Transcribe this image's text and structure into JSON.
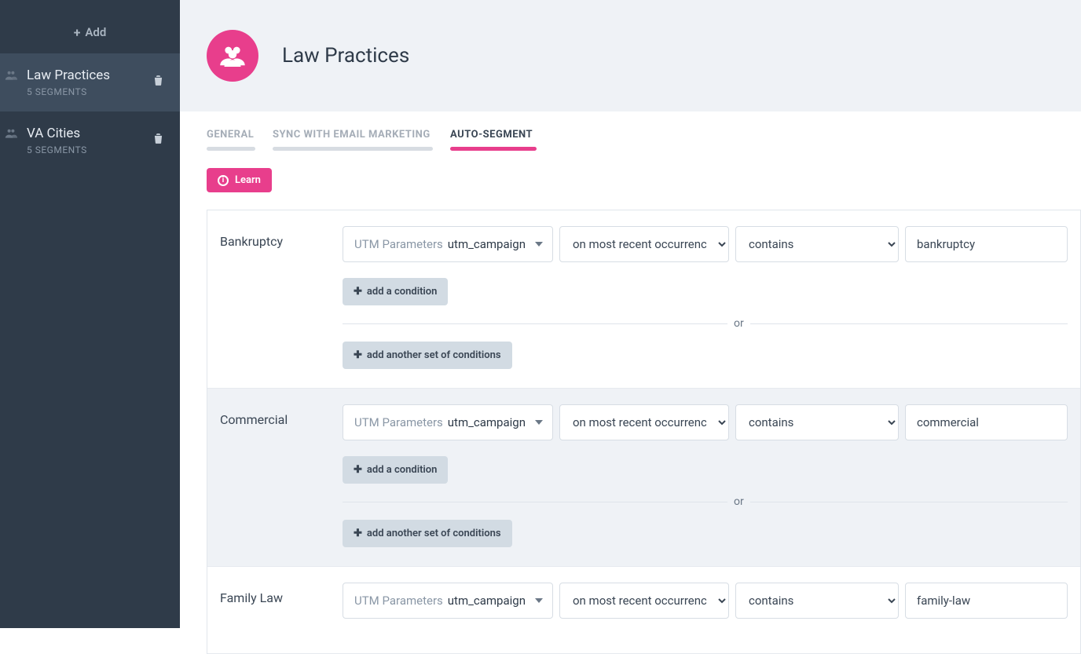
{
  "sidebar": {
    "add_label": "Add",
    "items": [
      {
        "title": "Law Practices",
        "sub": "5 SEGMENTS",
        "active": true
      },
      {
        "title": "VA Cities",
        "sub": "5 SEGMENTS",
        "active": false
      }
    ]
  },
  "header": {
    "title": "Law Practices"
  },
  "tabs": [
    {
      "label": "GENERAL",
      "active": false
    },
    {
      "label": "SYNC WITH EMAIL MARKETING",
      "active": false
    },
    {
      "label": "AUTO-SEGMENT",
      "active": true
    }
  ],
  "learn_label": "Learn",
  "labels": {
    "param_group": "UTM Parameters",
    "add_condition": "add a condition",
    "add_set": "add another set of conditions",
    "or": "or"
  },
  "options": {
    "occurrence": [
      "on most recent occurrence"
    ],
    "operator": [
      "contains"
    ]
  },
  "segments": [
    {
      "name": "Bankruptcy",
      "param": "utm_campaign",
      "occurrence": "on most recent occurrence",
      "operator": "contains",
      "value": "bankruptcy",
      "alt": false,
      "show_extra": true
    },
    {
      "name": "Commercial",
      "param": "utm_campaign",
      "occurrence": "on most recent occurrence",
      "operator": "contains",
      "value": "commercial",
      "alt": true,
      "show_extra": true
    },
    {
      "name": "Family Law",
      "param": "utm_campaign",
      "occurrence": "on most recent occurrence",
      "operator": "contains",
      "value": "family-law",
      "alt": false,
      "show_extra": false
    }
  ]
}
